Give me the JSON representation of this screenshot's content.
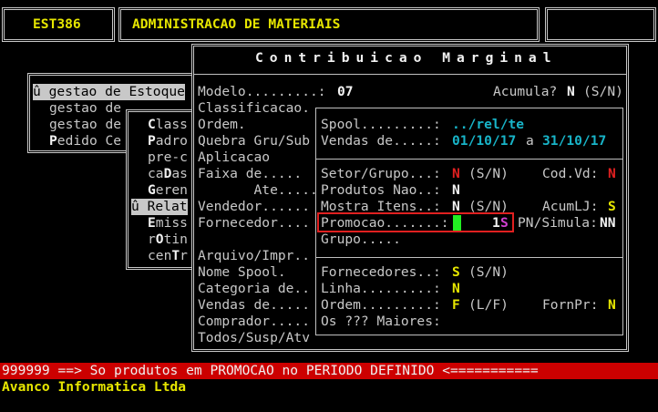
{
  "header": {
    "code": "EST386",
    "title": "ADMINISTRACAO DE MATERIAIS"
  },
  "menu1": {
    "items": [
      {
        "icon": "û",
        "text": " gestao de Estoque"
      },
      {
        "text": "gestao de"
      },
      {
        "text": "gestao de"
      },
      {
        "hot": "P",
        "text": "edido Ce"
      }
    ]
  },
  "menu2": {
    "items": [
      {
        "hot": "C",
        "text": "lass"
      },
      {
        "hot": "P",
        "text": "adro"
      },
      {
        "text": "pre-c"
      },
      {
        "pre": "ca",
        "hot": "D",
        "text": "as"
      },
      {
        "hot": "G",
        "text": "eren"
      },
      {
        "icon": "û",
        "text": " Relat"
      },
      {
        "hot": "E",
        "text": "miss"
      },
      {
        "pre": "r",
        "hot": "O",
        "text": "tin"
      },
      {
        "pre": "cen",
        "hot": "T",
        "text": "r"
      }
    ]
  },
  "main": {
    "title": "Contribuicao Marginal",
    "modelo_label": "Modelo.........:",
    "modelo_value": "07",
    "acumula_label": "Acumula?",
    "acumula_value": "N",
    "acumula_opts": "(S/N)",
    "left_labels": [
      "Classificacao.",
      "Ordem.",
      "Quebra Gru/Sub",
      "Aplicacao",
      "Faixa de.....",
      "       Ate.....",
      "Vendedor......",
      "Fornecedor....",
      "",
      "Arquivo/Impr..",
      "Nome Spool.",
      "Categoria de..",
      "Vendas de.....",
      "Comprador.....",
      "Todos/Susp/Atv"
    ]
  },
  "sub": {
    "spool_label": "Spool.........:",
    "spool_value": "../rel/te",
    "vendas_label": "Vendas de.....:",
    "vendas_from": "01/10/17",
    "vendas_a": "a",
    "vendas_to": "31/10/17",
    "setor_label": "Setor/Grupo...:",
    "setor_value": "N",
    "setor_opts": "(S/N)",
    "codvd_label": "Cod.Vd:",
    "codvd_value": "N",
    "produtos_label": "Produtos Nao..:",
    "produtos_value": "N",
    "mostra_label": "Mostra Itens..:",
    "mostra_value": "N",
    "mostra_opts": "(S/N)",
    "acumlj_label": "AcumLJ:",
    "acumlj_value": "S",
    "promocao_label": "Promocao.......:",
    "promocao_num": "1",
    "promocao_flag": "S",
    "pnsimula_label": "PN/Simula:",
    "pnsimula_value": "NN",
    "grupo_label": "Grupo.....",
    "fornecedores_label": "Fornecedores..:",
    "fornecedores_value": "S",
    "fornecedores_opts": "(S/N)",
    "linha_label": "Linha.........:",
    "linha_value": "N",
    "ordem_label": "Ordem.........:",
    "ordem_value": "F",
    "ordem_opts": "(L/F)",
    "fornpr_label": "FornPr:",
    "fornpr_value": "N",
    "os_label": "Os ??? Maiores:"
  },
  "status": {
    "message": "999999 ==> So produtos em PROMOCAO no PERIODO DEFINIDO <===========",
    "company": "Avanco Informatica Ltda"
  },
  "colors": {
    "status_bg": "#cc0000",
    "highlight_box": "#e02020",
    "cursor": "#22ee22"
  }
}
